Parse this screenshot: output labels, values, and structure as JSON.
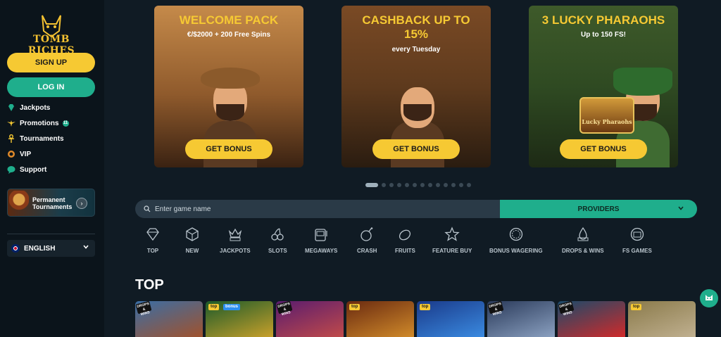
{
  "brand": {
    "logo_text": "TOMB RICHES",
    "accent_yellow": "#f6c933",
    "accent_green": "#1fae8c"
  },
  "sidebar": {
    "signup_label": "SIGN UP",
    "login_label": "LOG IN",
    "items": [
      {
        "label": "Jackpots",
        "icon": "diamond-icon"
      },
      {
        "label": "Promotions",
        "icon": "ankh-wings-icon",
        "badge": "11"
      },
      {
        "label": "Tournaments",
        "icon": "ankh-icon"
      },
      {
        "label": "VIP",
        "icon": "vip-icon"
      },
      {
        "label": "Support",
        "icon": "chat-bubble-icon"
      }
    ],
    "banner": {
      "line1": "Permanent",
      "line2": "Tournaments"
    },
    "language": "ENGLISH"
  },
  "promos": [
    {
      "title": "WELCOME PACK",
      "subtitle": "€/$2000 + 200 Free Spins",
      "button": "GET BONUS"
    },
    {
      "title_line1": "CASHBACK UP TO",
      "title_line2": "15%",
      "subtitle": "every Tuesday",
      "button": "GET BONUS"
    },
    {
      "title": "3 LUCKY PHARAOHS",
      "subtitle": "Up to 150 FS!",
      "button": "GET BONUS",
      "slot_logo": "Lucky Pharaohs"
    }
  ],
  "carousel": {
    "total_dots": 13,
    "active_index": 0
  },
  "search": {
    "placeholder": "Enter game name",
    "providers_label": "PROVIDERS"
  },
  "categories": [
    {
      "label": "TOP",
      "icon": "diamond-icon"
    },
    {
      "label": "NEW",
      "icon": "cube-icon"
    },
    {
      "label": "JACKPOTS",
      "icon": "crown-icon"
    },
    {
      "label": "SLOTS",
      "icon": "cherries-icon"
    },
    {
      "label": "MEGAWAYS",
      "icon": "slot-machine-icon"
    },
    {
      "label": "CRASH",
      "icon": "bomb-icon"
    },
    {
      "label": "FRUITS",
      "icon": "lemon-icon"
    },
    {
      "label": "FEATURE BUY",
      "icon": "star-icon"
    },
    {
      "label": "BONUS WAGERING",
      "icon": "wagering-icon"
    },
    {
      "label": "DROPS & WINS",
      "icon": "drops-wins-icon"
    },
    {
      "label": "FS GAMES",
      "icon": "fs-icon"
    }
  ],
  "top_section": {
    "title": "TOP",
    "games": [
      {
        "tags": [
          "DROPS & WINS"
        ],
        "color1": "#3a6ea5",
        "color2": "#a0522d"
      },
      {
        "tags": [
          "top",
          "bonus"
        ],
        "color1": "#1c5a2a",
        "color2": "#c8a02a"
      },
      {
        "tags": [
          "DROPS & WINS"
        ],
        "color1": "#5a1c6e",
        "color2": "#c04a4a"
      },
      {
        "tags": [
          "top"
        ],
        "color1": "#6a2a10",
        "color2": "#d08a2a"
      },
      {
        "tags": [
          "top"
        ],
        "color1": "#1a3a8a",
        "color2": "#3a8ae0"
      },
      {
        "tags": [
          "DROPS & WINS"
        ],
        "color1": "#2a3a5a",
        "color2": "#8aa0c0"
      },
      {
        "tags": [
          "DROPS & WINS"
        ],
        "color1": "#1a4a6a",
        "color2": "#d02a2a"
      },
      {
        "tags": [
          "top"
        ],
        "color1": "#8a7a4a",
        "color2": "#c0b090"
      }
    ]
  }
}
